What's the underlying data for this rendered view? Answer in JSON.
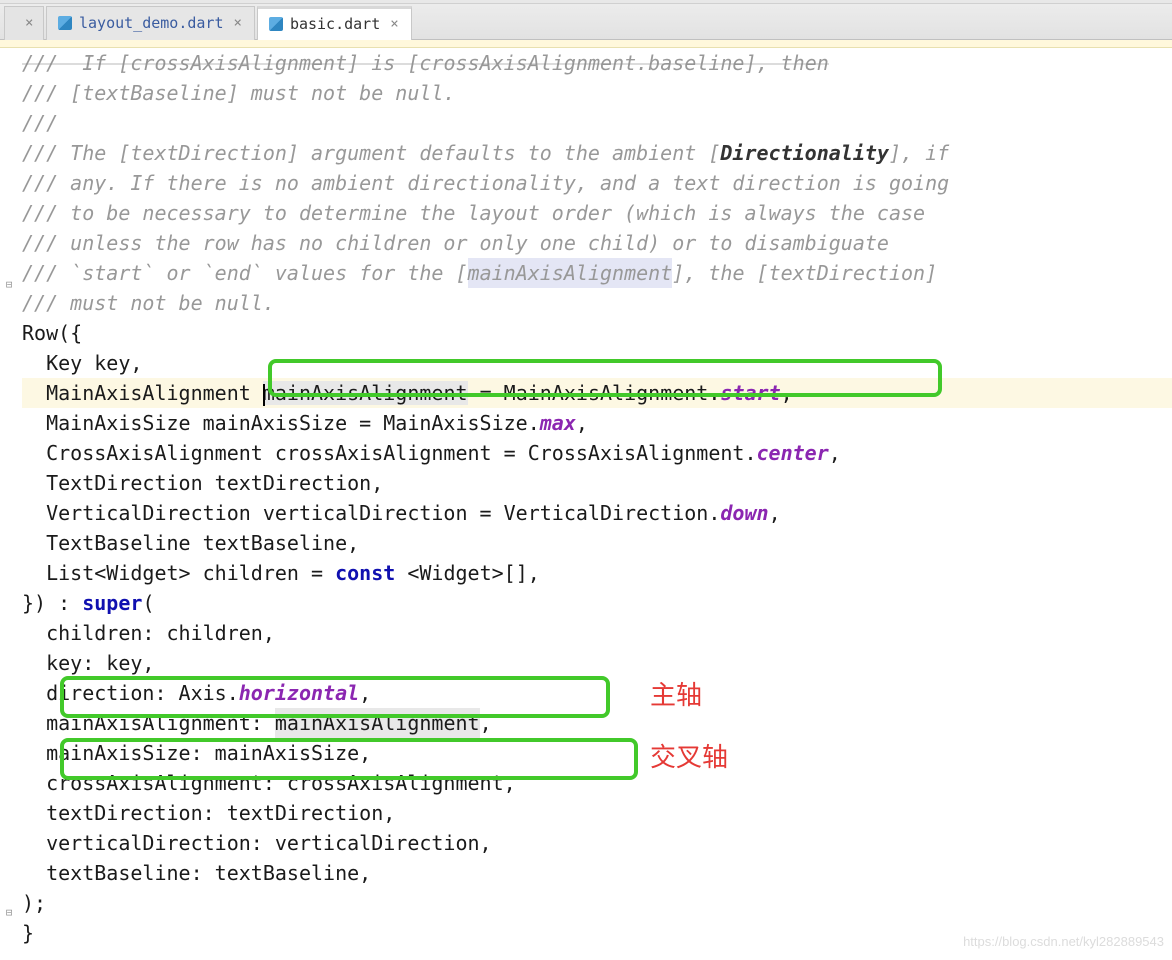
{
  "tabs": {
    "inactive": {
      "label": "layout_demo.dart"
    },
    "active": {
      "label": "basic.dart"
    }
  },
  "code": {
    "l0a": "///  If ",
    "l0b": "[crossAxisAlignment]",
    "l0c": " is ",
    "l0d": "[crossAxisAlignment.baseline]",
    "l0e": ", then",
    "l1": "/// [textBaseline] must not be null.",
    "l2": "///",
    "l3a": "/// The [textDirection] argument defaults to the ambient [",
    "l3b": "Directionality",
    "l3c": "], if",
    "l4": "/// any. If there is no ambient directionality, and a text direction is going",
    "l5": "/// to be necessary to determine the layout order (which is always the case",
    "l6": "/// unless the row has no children or only one child) or to disambiguate",
    "l7a": "/// `start` or `end` values for the [",
    "l7b": "mainAxisAlignment",
    "l7c": "], the [textDirection]",
    "l8": "/// must not be null.",
    "l9": "Row({",
    "l10": "  Key key,",
    "l11a": "  MainAxisAlignment ",
    "l11b": "mainAxisAlignment",
    "l11c": " = MainAxisAlignment.",
    "l11d": "start",
    "l11e": ",",
    "l12a": "  MainAxisSize mainAxisSize = MainAxisSize.",
    "l12b": "max",
    "l12c": ",",
    "l13a": "  CrossAxisAlignment crossAxisAlignment = CrossAxisAlignment.",
    "l13b": "center",
    "l13c": ",",
    "l14": "  TextDirection textDirection,",
    "l15a": "  VerticalDirection verticalDirection = VerticalDirection.",
    "l15b": "down",
    "l15c": ",",
    "l16": "  TextBaseline textBaseline,",
    "l17a": "  List<Widget> children = ",
    "l17b": "const",
    "l17c": " <Widget>[],",
    "l18a": "}) : ",
    "l18b": "super",
    "l18c": "(",
    "l19": "  children: children,",
    "l20": "  key: key,",
    "l21a": "  direction: Axis.",
    "l21b": "horizontal",
    "l21c": ",",
    "l22a": "  mainAxisAlignment: ",
    "l22b": "mainAxisAlignment",
    "l22c": ",",
    "l23": "  mainAxisSize: mainAxisSize,",
    "l24": "  crossAxisAlignment: crossAxisAlignment,",
    "l25": "  textDirection: textDirection,",
    "l26": "  verticalDirection: verticalDirection,",
    "l27": "  textBaseline: textBaseline,",
    "l28": ");",
    "l29": "}"
  },
  "annotations": {
    "a1": "主轴",
    "a2": "交叉轴"
  },
  "watermark": "https://blog.csdn.net/kyl282889543"
}
